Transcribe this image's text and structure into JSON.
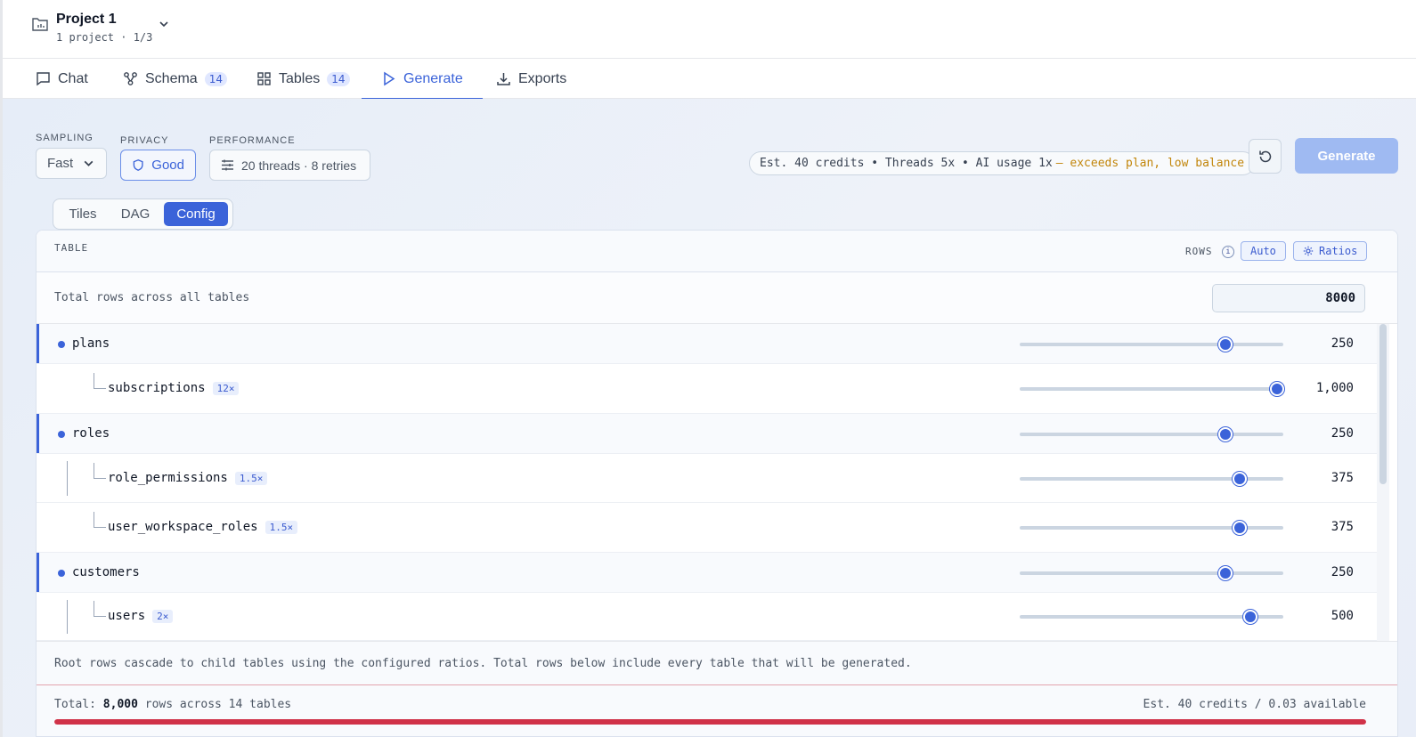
{
  "project": {
    "name": "Project 1",
    "subtitle": "1 project · 1/3"
  },
  "tabs": [
    {
      "label": "Chat",
      "badge": null
    },
    {
      "label": "Schema",
      "badge": "14"
    },
    {
      "label": "Tables",
      "badge": "14"
    },
    {
      "label": "Generate",
      "badge": null,
      "active": true
    },
    {
      "label": "Exports",
      "badge": null
    }
  ],
  "controls": {
    "sampling": {
      "label": "SAMPLING",
      "value": "Fast"
    },
    "privacy": {
      "label": "PRIVACY",
      "value": "Good"
    },
    "performance": {
      "label": "PERFORMANCE",
      "value": "20 threads · 8 retries"
    }
  },
  "estimate": {
    "text": "Est. 40 credits • Threads 5x • AI usage 1x",
    "warning": "— exceeds plan, low balance"
  },
  "generate_label": "Generate",
  "views": [
    {
      "label": "Tiles"
    },
    {
      "label": "DAG"
    },
    {
      "label": "Config",
      "active": true
    }
  ],
  "panel": {
    "table_label": "TABLE",
    "rows_label": "ROWS",
    "info_glyph": "i",
    "auto_label": "Auto",
    "ratios_label": "Ratios",
    "total_label": "Total rows across all tables",
    "total_value": "8000"
  },
  "rows": [
    {
      "name": "plans",
      "root": true,
      "ratio": null,
      "value": "250",
      "slider": 0.78
    },
    {
      "name": "subscriptions",
      "root": false,
      "ratio": "12×",
      "value": "1,000",
      "slider": 0.975
    },
    {
      "name": "roles",
      "root": true,
      "ratio": null,
      "value": "250",
      "slider": 0.78
    },
    {
      "name": "role_permissions",
      "root": false,
      "ratio": "1.5×",
      "value": "375",
      "slider": 0.835
    },
    {
      "name": "user_workspace_roles",
      "root": false,
      "ratio": "1.5×",
      "value": "375",
      "slider": 0.835
    },
    {
      "name": "customers",
      "root": true,
      "ratio": null,
      "value": "250",
      "slider": 0.78
    },
    {
      "name": "users",
      "root": false,
      "ratio": "2×",
      "value": "500",
      "slider": 0.875
    }
  ],
  "note": "Root rows cascade to child tables using the configured ratios. Total rows below include every table that will be generated.",
  "footer": {
    "prefix": "Total: ",
    "total": "8,000",
    "suffix": " rows across 14 tables",
    "credits": "Est. 40 credits / 0.03 available",
    "progress": 1.0
  },
  "colors": {
    "accent": "#3b63d9",
    "warning": "#c2860b",
    "danger": "#d03248"
  }
}
